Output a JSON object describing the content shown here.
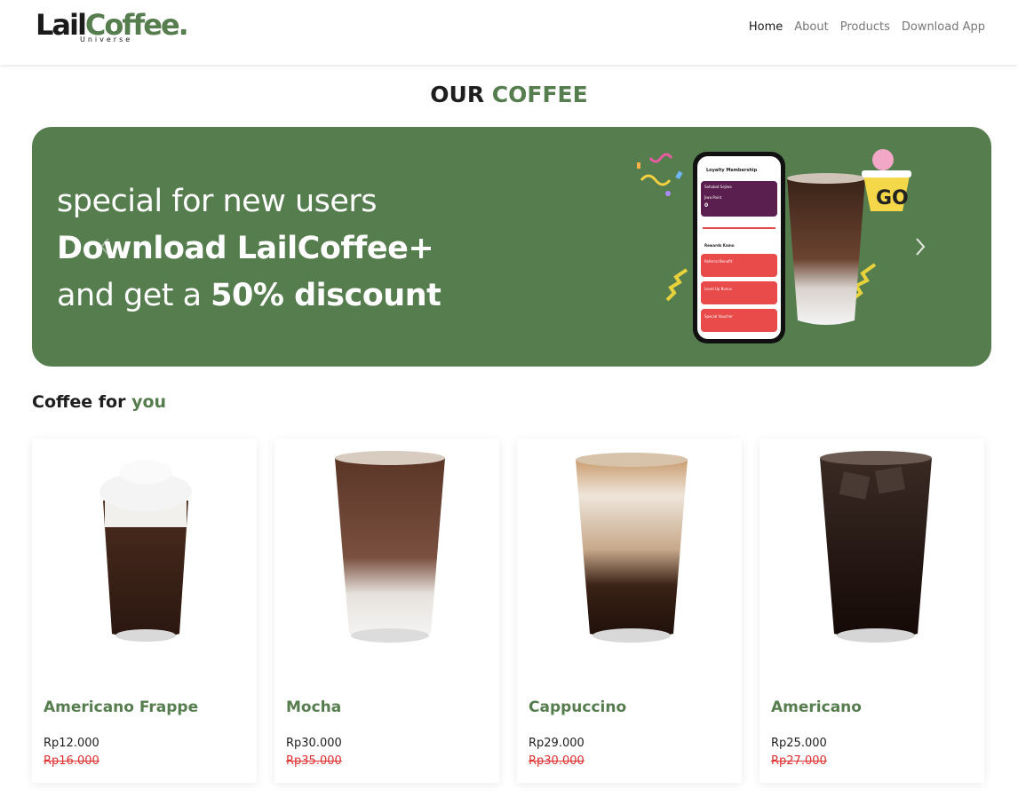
{
  "brand": {
    "name_part1": "Lail",
    "name_part2": "Coffee.",
    "subtitle": "Universe"
  },
  "nav": {
    "items": [
      {
        "label": "Home",
        "active": true
      },
      {
        "label": "About"
      },
      {
        "label": "Products"
      },
      {
        "label": "Download App"
      }
    ]
  },
  "section_title": {
    "part1": "OUR",
    "part2": "COFFEE"
  },
  "banner": {
    "line1": "special for new users",
    "line2": "Download LailCoffee+",
    "line3_prefix": "and get a",
    "line3_bold": "50% discount",
    "prev_icon": "chevron-left-icon",
    "next_icon": "chevron-right-icon",
    "phone": {
      "title": "Loyalty Membership",
      "referral": "Sahabat Sejiwa",
      "points_label": "Jiwa Point",
      "points_value": "0",
      "rewards_label": "Rewards Kamu",
      "cards": [
        "Referral Benefit",
        "Level Up Bonus",
        "Special Voucher"
      ]
    }
  },
  "coffee_section": {
    "part1": "Coffee for",
    "part2": "you"
  },
  "products": [
    {
      "name": "Americano Frappe",
      "price": "Rp12.000",
      "old_price": "Rp16.000"
    },
    {
      "name": "Mocha",
      "price": "Rp30.000",
      "old_price": "Rp35.000"
    },
    {
      "name": "Cappuccino",
      "price": "Rp29.000",
      "old_price": "Rp30.000"
    },
    {
      "name": "Americano",
      "price": "Rp25.000",
      "old_price": "Rp27.000"
    }
  ],
  "colors": {
    "accent": "#567d4e",
    "discount_red": "#e03030"
  }
}
